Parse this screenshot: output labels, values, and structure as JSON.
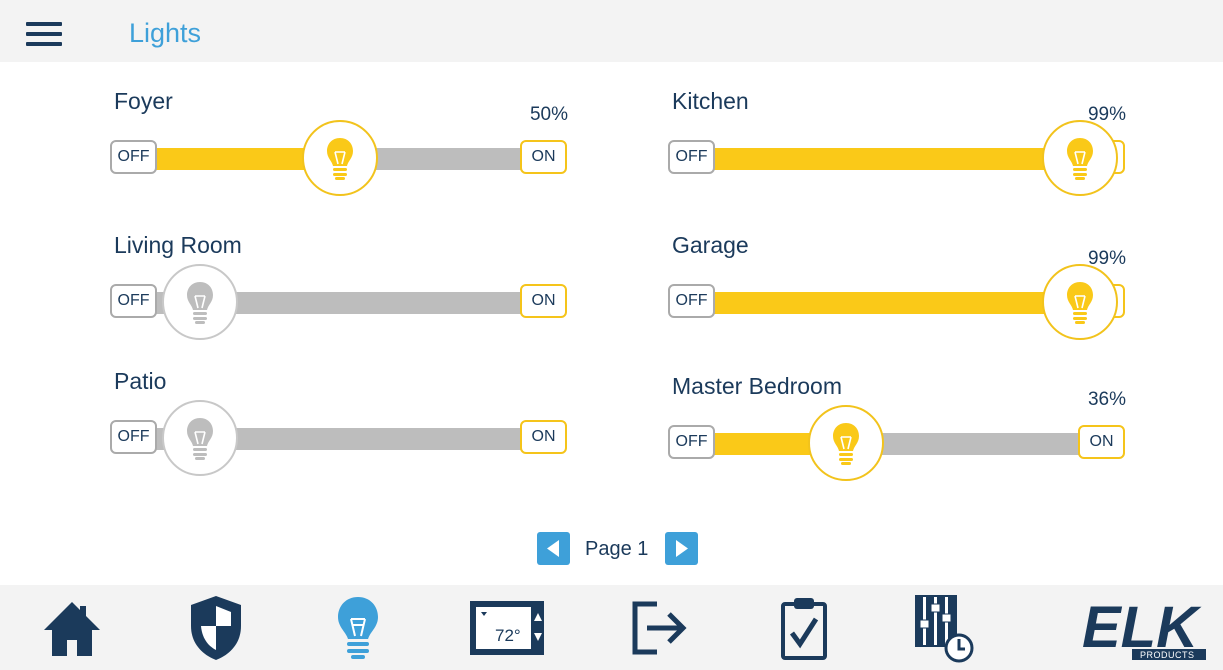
{
  "header": {
    "title": "Lights",
    "menu_icon": "hamburger-menu-icon"
  },
  "colors": {
    "accent": "#3ea0d9",
    "on": "#fac918",
    "off": "#bdbdbd",
    "text": "#1b3a5b"
  },
  "lights": [
    {
      "name": "Foyer",
      "level": 0.5,
      "level_label": "50%",
      "off_label": "OFF",
      "on_label": "ON",
      "lit": true
    },
    {
      "name": "Kitchen",
      "level": 0.99,
      "level_label": "99%",
      "off_label": "OFF",
      "on_label": "ON",
      "lit": true
    },
    {
      "name": "Living Room",
      "level": 0,
      "level_label": "",
      "off_label": "OFF",
      "on_label": "ON",
      "lit": false
    },
    {
      "name": "Garage",
      "level": 0.99,
      "level_label": "99%",
      "off_label": "OFF",
      "on_label": "ON",
      "lit": true
    },
    {
      "name": "Patio",
      "level": 0,
      "level_label": "",
      "off_label": "OFF",
      "on_label": "ON",
      "lit": false
    },
    {
      "name": "Master Bedroom",
      "level": 0.36,
      "level_label": "36%",
      "off_label": "OFF",
      "on_label": "ON",
      "lit": true
    }
  ],
  "pager": {
    "label": "Page 1",
    "prev_icon": "arrow-left-icon",
    "next_icon": "arrow-right-icon"
  },
  "nav": {
    "items": [
      {
        "name": "home",
        "icon": "home-icon"
      },
      {
        "name": "security",
        "icon": "shield-icon"
      },
      {
        "name": "lights",
        "icon": "lightbulb-icon",
        "active": true
      },
      {
        "name": "thermostat",
        "icon": "thermostat-icon",
        "temperature": "72°"
      },
      {
        "name": "outputs",
        "icon": "exit-arrow-icon"
      },
      {
        "name": "tasks",
        "icon": "clipboard-check-icon"
      },
      {
        "name": "automation",
        "icon": "sliders-clock-icon"
      }
    ],
    "logo": {
      "text": "ELK",
      "subtext": "PRODUCTS",
      "icon": "elk-logo"
    }
  }
}
